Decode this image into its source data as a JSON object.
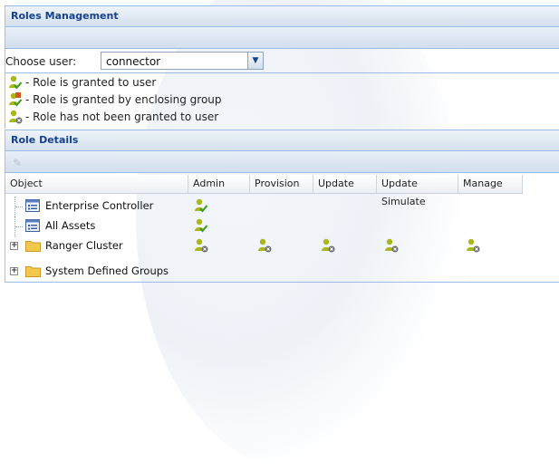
{
  "roles_panel": {
    "title": "Roles Management",
    "choose_user_label": "Choose user:",
    "user_value": "connector",
    "legend": [
      {
        "icon": "role-granted-icon",
        "text": "- Role is granted to user"
      },
      {
        "icon": "role-granted-by-group-icon",
        "text": "- Role is granted by enclosing group"
      },
      {
        "icon": "role-not-granted-icon",
        "text": "- Role has not been granted to user"
      }
    ]
  },
  "details_panel": {
    "title": "Role Details",
    "toolbar": {
      "edit_icon": "pencil-icon"
    },
    "columns": [
      "Object",
      "Admin",
      "Provision",
      "Update",
      "Update Simulate",
      "Manage"
    ],
    "rows": [
      {
        "label": "Enterprise Controller",
        "icon": "controller-icon",
        "expandable": false,
        "roles": {
          "admin": "granted",
          "provision": "",
          "update": "",
          "update_simulate": "",
          "manage": ""
        }
      },
      {
        "label": "All Assets",
        "icon": "controller-icon",
        "expandable": false,
        "roles": {
          "admin": "granted",
          "provision": "",
          "update": "",
          "update_simulate": "",
          "manage": ""
        }
      },
      {
        "label": "Ranger Cluster",
        "icon": "folder-icon",
        "expandable": true,
        "roles": {
          "admin": "not-granted",
          "provision": "not-granted",
          "update": "not-granted",
          "update_simulate": "not-granted",
          "manage": "not-granted"
        }
      },
      {
        "label": "System Defined Groups",
        "icon": "folder-icon",
        "expandable": true,
        "roles": {
          "admin": "",
          "provision": "",
          "update": "",
          "update_simulate": "",
          "manage": ""
        }
      }
    ]
  },
  "colors": {
    "header_text": "#15428b",
    "panel_border": "#99bbe8",
    "user_icon": "#a8b81a",
    "granted_check": "#3a9a1a",
    "group_badge": "#d05a1a",
    "not_granted_badge": "#6b6b6b",
    "folder": "#f3c84b"
  }
}
